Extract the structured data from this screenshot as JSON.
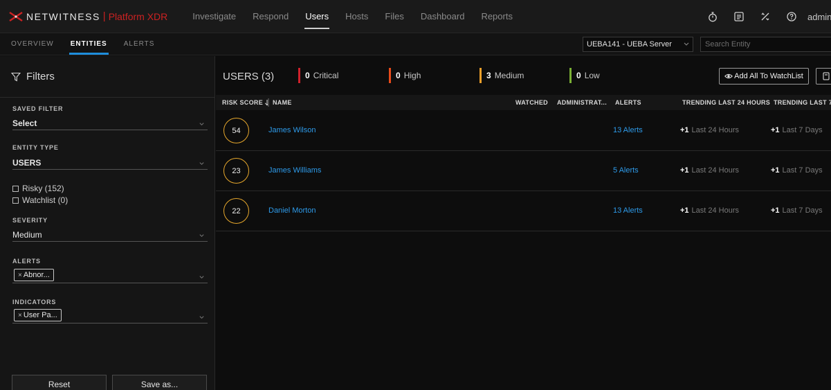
{
  "brand": {
    "name": "NETWITNESS",
    "separator": "|",
    "product": "Platform XDR"
  },
  "nav": {
    "items": [
      {
        "label": "Investigate"
      },
      {
        "label": "Respond"
      },
      {
        "label": "Users"
      },
      {
        "label": "Hosts"
      },
      {
        "label": "Files"
      },
      {
        "label": "Dashboard"
      },
      {
        "label": "Reports"
      }
    ],
    "active": "Users",
    "user": "admin"
  },
  "subnav": {
    "tabs": [
      {
        "label": "OVERVIEW"
      },
      {
        "label": "ENTITIES"
      },
      {
        "label": "ALERTS"
      }
    ],
    "active": "ENTITIES",
    "server": "UEBA141 - UEBA Server",
    "search_placeholder": "Search Entity"
  },
  "filters": {
    "title": "Filters",
    "saved_filter_label": "SAVED FILTER",
    "saved_filter_value": "Select",
    "entity_type_label": "ENTITY TYPE",
    "entity_type_value": "USERS",
    "risky": "Risky (152)",
    "watchlist": "Watchlist (0)",
    "severity_label": "SEVERITY",
    "severity_value": "Medium",
    "alerts_label": "ALERTS",
    "alerts_chip": "Abnor...",
    "indicators_label": "INDICATORS",
    "indicators_chip": "User Pa...",
    "reset": "Reset",
    "save_as": "Save as..."
  },
  "summary": {
    "users": "USERS (3)",
    "critical": {
      "count": "0",
      "label": "Critical",
      "color": "#d0212b"
    },
    "high": {
      "count": "0",
      "label": "High",
      "color": "#e84a1a"
    },
    "medium": {
      "count": "3",
      "label": "Medium",
      "color": "#f0a02a"
    },
    "low": {
      "count": "0",
      "label": "Low",
      "color": "#7ab034"
    },
    "add_all": "Add All To WatchList"
  },
  "table": {
    "columns": {
      "risk": "RISK SCORE",
      "name": "NAME",
      "watched": "WATCHED",
      "admin": "ADMINISTRAT...",
      "alerts": "ALERTS",
      "trend24": "TRENDING LAST 24 HOURS",
      "trend7": "TRENDING LAST 7 D"
    },
    "rows": [
      {
        "score": "54",
        "name": "James Wilson",
        "alerts": "13 Alerts",
        "t24": "+1",
        "t24_label": "Last 24 Hours",
        "t7": "+1",
        "t7_label": "Last 7 Days"
      },
      {
        "score": "23",
        "name": "James Williams",
        "alerts": "5 Alerts",
        "t24": "+1",
        "t24_label": "Last 24 Hours",
        "t7": "+1",
        "t7_label": "Last 7 Days"
      },
      {
        "score": "22",
        "name": "Daniel Morton",
        "alerts": "13 Alerts",
        "t24": "+1",
        "t24_label": "Last 24 Hours",
        "t7": "+1",
        "t7_label": "Last 7 Days"
      }
    ]
  },
  "colors": {
    "accent": "#1e8ddb",
    "link": "#2e9bea",
    "brand_red": "#cc2222",
    "score_ring": "#e6a72c"
  }
}
